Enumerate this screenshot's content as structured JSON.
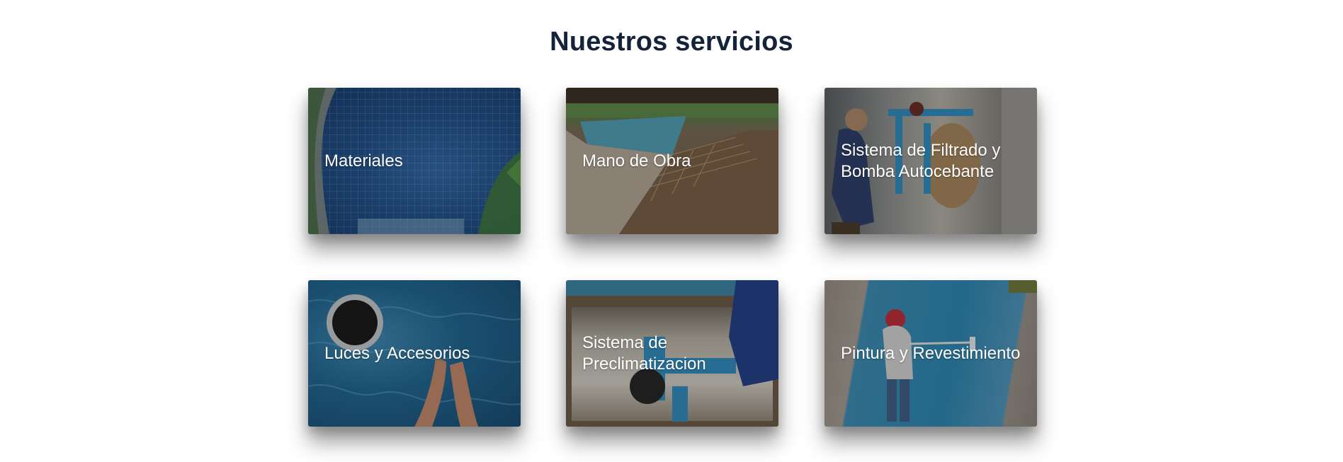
{
  "section": {
    "title": "Nuestros servicios"
  },
  "services": [
    {
      "label": "Materiales"
    },
    {
      "label": "Mano de Obra"
    },
    {
      "label": "Sistema de Filtrado y Bomba Autocebante"
    },
    {
      "label": "Luces y Accesorios"
    },
    {
      "label": "Sistema de Preclimatizacion"
    },
    {
      "label": "Pintura y Revestimiento"
    }
  ]
}
